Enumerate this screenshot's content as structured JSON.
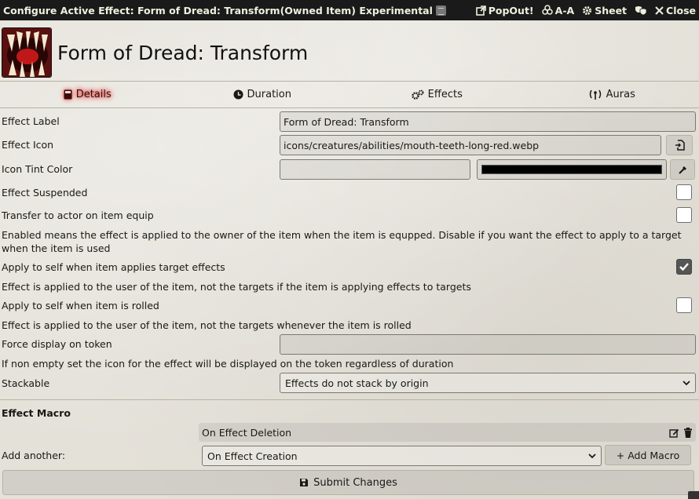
{
  "window": {
    "title": "Configure Active Effect: Form of Dread: Transform(Owned Item) Experimental",
    "popout_label": "PopOut!",
    "aa_label": "A-A",
    "sheet_label": "Sheet",
    "close_label": "Close"
  },
  "header": {
    "name": "Form of Dread: Transform"
  },
  "tabs": [
    {
      "label": "Details",
      "icon": "book-icon",
      "active": true
    },
    {
      "label": "Duration",
      "icon": "clock-icon",
      "active": false
    },
    {
      "label": "Effects",
      "icon": "cogs-icon",
      "active": false
    },
    {
      "label": "Auras",
      "icon": "broadcast-icon",
      "active": false
    }
  ],
  "fields": {
    "effect_label": {
      "label": "Effect Label",
      "value": "Form of Dread: Transform"
    },
    "effect_icon": {
      "label": "Effect Icon",
      "value": "icons/creatures/abilities/mouth-teeth-long-red.webp"
    },
    "icon_tint": {
      "label": "Icon Tint Color",
      "value": "",
      "swatch": "#000000"
    },
    "suspended": {
      "label": "Effect Suspended",
      "checked": false
    },
    "transfer": {
      "label": "Transfer to actor on item equip",
      "checked": false,
      "hint": "Enabled means the effect is applied to the owner of the item when the item is equpped. Disable if you want the effect to apply to a target when the item is used"
    },
    "self_target": {
      "label": "Apply to self when item applies target effects",
      "checked": true,
      "hint": "Effect is applied to the user of the item, not the targets if the item is applying effects to targets"
    },
    "self_rolled": {
      "label": "Apply to self when item is rolled",
      "checked": false,
      "hint": "Effect is applied to the user of the item, not the targets whenever the item is rolled"
    },
    "force_display": {
      "label": "Force display on token",
      "value": "",
      "hint": "If non empty set the icon for the effect will be displayed on the token regardless of duration"
    },
    "stackable": {
      "label": "Stackable",
      "value": "Effects do not stack by origin"
    }
  },
  "macro": {
    "section_title": "Effect Macro",
    "existing": "On Effect Deletion",
    "add_label": "Add another:",
    "add_select": "On Effect Creation",
    "add_button": "+ Add Macro"
  },
  "submit_label": "Submit Changes"
}
